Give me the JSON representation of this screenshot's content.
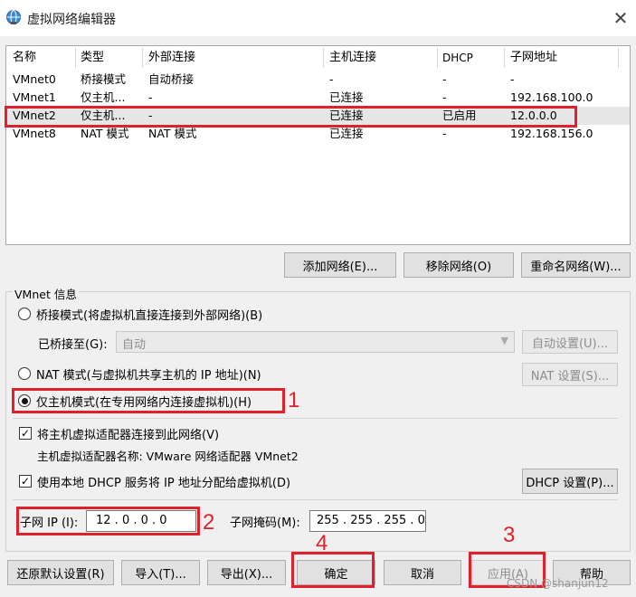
{
  "window": {
    "title": "虚拟网络编辑器",
    "close_glyph": "✕"
  },
  "table": {
    "headers": [
      "名称",
      "类型",
      "外部连接",
      "主机连接",
      "DHCP",
      "子网地址"
    ],
    "rows": [
      [
        "VMnet0",
        "桥接模式",
        "自动桥接",
        "-",
        "-",
        "-"
      ],
      [
        "VMnet1",
        "仅主机...",
        "-",
        "已连接",
        "-",
        "192.168.100.0"
      ],
      [
        "VMnet2",
        "仅主机...",
        "-",
        "已连接",
        "已启用",
        "12.0.0.0"
      ],
      [
        "VMnet8",
        "NAT 模式",
        "NAT 模式",
        "已连接",
        "-",
        "192.168.156.0"
      ]
    ],
    "selected_row": 2
  },
  "list_buttons": {
    "add": "添加网络(E)...",
    "remove": "移除网络(O)",
    "rename": "重命名网络(W)..."
  },
  "vmnet_info": {
    "title": "VMnet 信息",
    "bridge_mode": "桥接模式(将虚拟机直接连接到外部网络)(B)",
    "bridged_to_label": "已桥接至(G):",
    "bridged_to_value": "自动",
    "auto_settings": "自动设置(U)...",
    "nat_mode": "NAT 模式(与虚拟机共享主机的 IP 地址)(N)",
    "nat_settings": "NAT 设置(S)...",
    "host_only_mode": "仅主机模式(在专用网络内连接虚拟机)(H)",
    "selected_mode": "host_only",
    "connect_adapter": "将主机虚拟适配器连接到此网络(V)",
    "connect_adapter_checked": true,
    "adapter_name": "主机虚拟适配器名称: VMware 网络适配器 VMnet2",
    "use_dhcp": "使用本地 DHCP 服务将 IP 地址分配给虚拟机(D)",
    "use_dhcp_checked": true,
    "dhcp_settings": "DHCP 设置(P)...",
    "subnet_ip_label": "子网 IP (I):",
    "subnet_ip": "12 . 0 . 0 . 0",
    "subnet_mask_label": "子网掩码(M):",
    "subnet_mask": "255 . 255 . 255 . 0"
  },
  "footer_buttons": {
    "restore": "还原默认设置(R)",
    "import": "导入(T)...",
    "export": "导出(X)...",
    "ok": "确定",
    "cancel": "取消",
    "apply": "应用(A)",
    "help": "帮助"
  },
  "annotations": [
    "1",
    "2",
    "3",
    "4"
  ],
  "watermark": "CSDN @shanjun12",
  "colors": {
    "annotation_red": "#e0202c",
    "selected_row": "#e6e6e6"
  }
}
